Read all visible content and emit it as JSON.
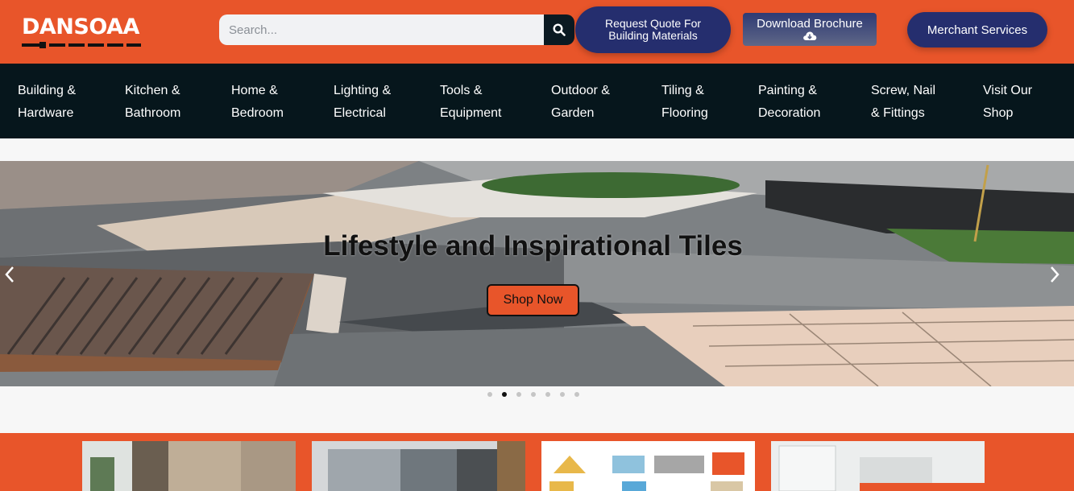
{
  "header": {
    "logo_text": "DANSOAA",
    "search": {
      "placeholder": "Search..."
    },
    "request_quote": {
      "line1": "Request Quote For",
      "line2": "Building Materials"
    },
    "download_brochure": {
      "label": "Download Brochure",
      "icon": "cloud-download-icon"
    },
    "merchant_services": {
      "label": "Merchant Services"
    },
    "colors": {
      "brand_orange": "#e8552a",
      "navy": "#252e6e",
      "nav_bg": "#06161c"
    }
  },
  "nav": {
    "items": [
      {
        "line1": "Building &",
        "line2": "Hardware"
      },
      {
        "line1": "Kitchen &",
        "line2": "Bathroom"
      },
      {
        "line1": "Home &",
        "line2": "Bedroom"
      },
      {
        "line1": "Lighting &",
        "line2": "Electrical"
      },
      {
        "line1": "Tools &",
        "line2": "Equipment"
      },
      {
        "line1": "Outdoor &",
        "line2": "Garden"
      },
      {
        "line1": "Tiling &",
        "line2": "Flooring"
      },
      {
        "line1": "Painting &",
        "line2": "Decoration"
      },
      {
        "line1": "Screw, Nail",
        "line2": "& Fittings"
      },
      {
        "line1": "Visit Our",
        "line2": "Shop"
      }
    ]
  },
  "hero": {
    "title": "Lifestyle and Inspirational Tiles",
    "button": "Shop Now",
    "prev_icon": "chevron-left-icon",
    "next_icon": "chevron-right-icon",
    "slide_count": 7,
    "active_slide": 2
  }
}
